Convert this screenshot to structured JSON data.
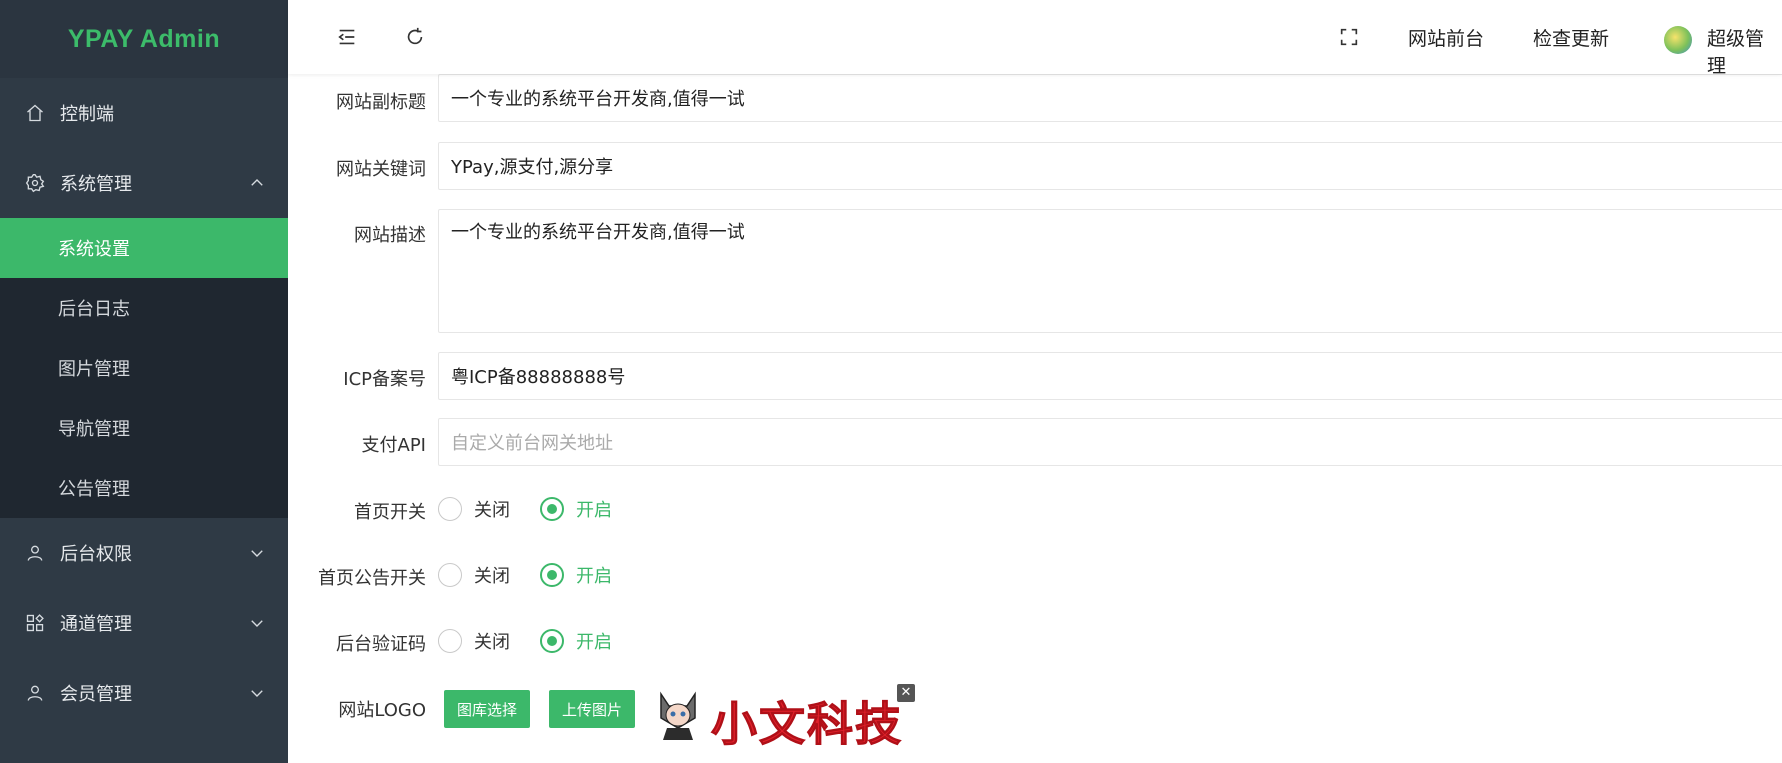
{
  "brand": "YPAY Admin",
  "sidebar": {
    "items": [
      {
        "label": "控制端",
        "icon": "home-icon"
      },
      {
        "label": "系统管理",
        "icon": "gear-icon",
        "expanded": true
      },
      {
        "label": "后台权限",
        "icon": "user-icon"
      },
      {
        "label": "通道管理",
        "icon": "apps-icon"
      },
      {
        "label": "会员管理",
        "icon": "user-icon"
      }
    ],
    "submenu": [
      {
        "label": "系统设置",
        "active": true
      },
      {
        "label": "后台日志"
      },
      {
        "label": "图片管理"
      },
      {
        "label": "导航管理"
      },
      {
        "label": "公告管理"
      }
    ]
  },
  "topbar": {
    "frontend_link": "网站前台",
    "update_link": "检查更新",
    "user_name": "超级管理"
  },
  "form": {
    "subtitle": {
      "label": "网站副标题",
      "value": "一个专业的系统平台开发商,值得一试"
    },
    "keywords": {
      "label": "网站关键词",
      "value": "YPay,源支付,源分享"
    },
    "description": {
      "label": "网站描述",
      "value": "一个专业的系统平台开发商,值得一试"
    },
    "icp": {
      "label": "ICP备案号",
      "value": "粤ICP备88888888号"
    },
    "pay_api": {
      "label": "支付API",
      "placeholder": "自定义前台网关地址"
    },
    "home_switch": {
      "label": "首页开关",
      "off": "关闭",
      "on": "开启",
      "selected": "on"
    },
    "notice_switch": {
      "label": "首页公告开关",
      "off": "关闭",
      "on": "开启",
      "selected": "on"
    },
    "captcha_switch": {
      "label": "后台验证码",
      "off": "关闭",
      "on": "开启",
      "selected": "on"
    },
    "logo": {
      "label": "网站LOGO",
      "gallery_button": "图库选择",
      "upload_button": "上传图片",
      "preview_text": "小文科技"
    }
  },
  "colors": {
    "accent": "#3cb86a",
    "sidebar": "#2f3a45",
    "submenu": "#1f2730"
  }
}
